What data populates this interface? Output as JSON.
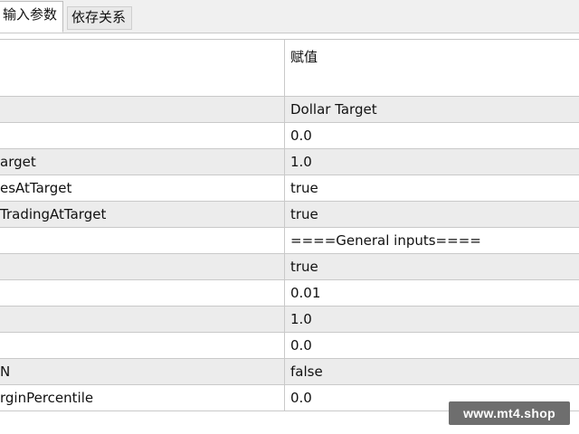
{
  "tabs": [
    {
      "label": "输入参数",
      "active": true
    },
    {
      "label": "依存关系",
      "active": false
    }
  ],
  "table": {
    "value_header": "赋值",
    "rows": [
      {
        "name": "",
        "value": "Dollar Target"
      },
      {
        "name": "",
        "value": "0.0"
      },
      {
        "name": "arget",
        "value": "1.0"
      },
      {
        "name": "esAtTarget",
        "value": "true"
      },
      {
        "name": "TradingAtTarget",
        "value": "true"
      },
      {
        "name": "",
        "value": "====General inputs===="
      },
      {
        "name": "",
        "value": "true"
      },
      {
        "name": "",
        "value": "0.01"
      },
      {
        "name": "",
        "value": "1.0"
      },
      {
        "name": "",
        "value": "0.0"
      },
      {
        "name": "N",
        "value": "false"
      },
      {
        "name": "rginPercentile",
        "value": "0.0"
      }
    ]
  },
  "watermark": "www.mt4.shop"
}
